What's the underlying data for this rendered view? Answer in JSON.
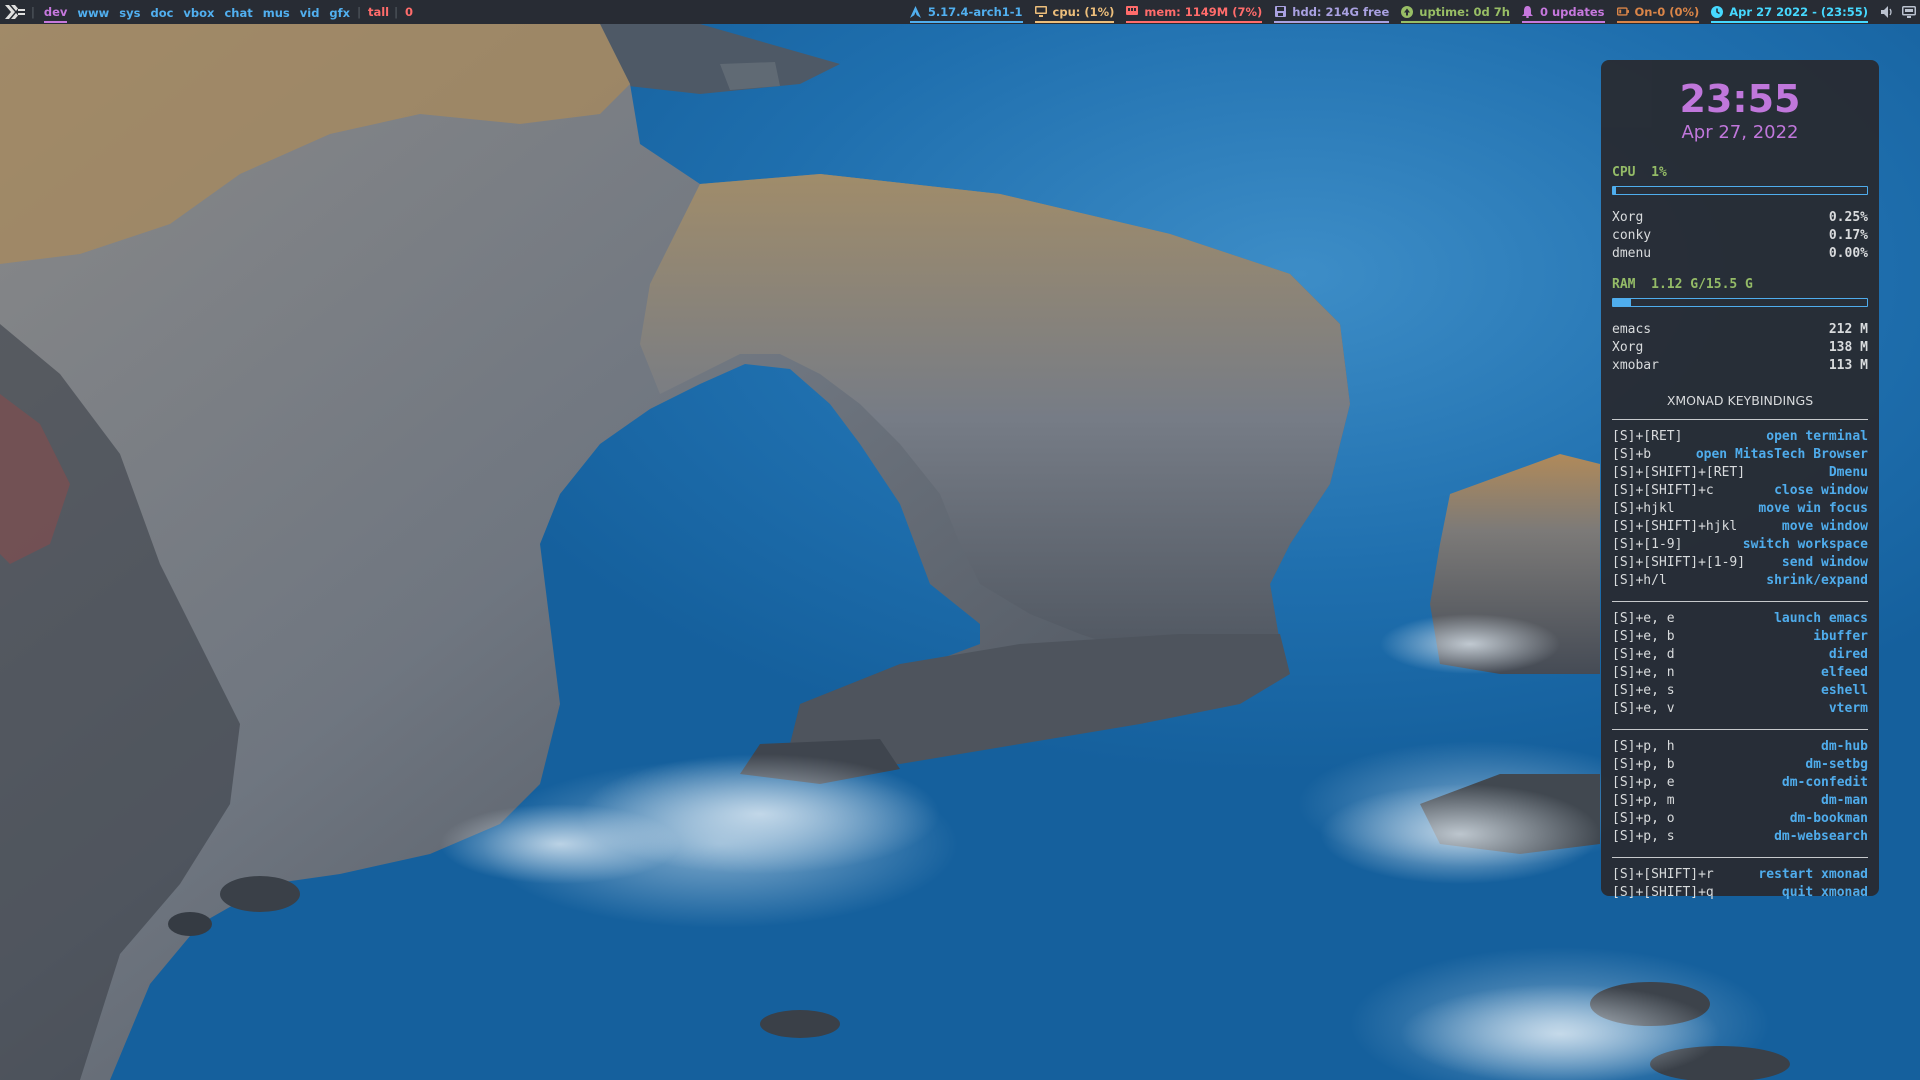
{
  "colors": {
    "bar_bg": "#282c34",
    "workspace": "#51afef",
    "workspace_active": "#c678dd",
    "layout": "#ff6c6b",
    "kernel": "#51afef",
    "cpu": "#ecbe7b",
    "mem": "#ff6c6b",
    "hdd": "#a9a1e1",
    "uptime": "#98be65",
    "updates": "#c678dd",
    "battery": "#da8548",
    "date": "#46d9ff",
    "conky_bg": "#282c34",
    "conky_accent": "#c678dd",
    "conky_green": "#98be65",
    "conky_blue": "#51afef"
  },
  "topbar": {
    "logo_icon": "xmonad-logo-icon",
    "workspaces": [
      "dev",
      "www",
      "sys",
      "doc",
      "vbox",
      "chat",
      "mus",
      "vid",
      "gfx"
    ],
    "active_workspace_index": 0,
    "layout": "tall",
    "window_count": "0",
    "modules": {
      "kernel": {
        "icon": "arch-linux-icon",
        "text": "5.17.4-arch1-1"
      },
      "cpu": {
        "icon": "monitor-icon",
        "text": "cpu: (1%)"
      },
      "mem": {
        "icon": "memory-icon",
        "text": "mem: 1149M (7%)"
      },
      "hdd": {
        "icon": "disk-icon",
        "text": "hdd: 214G free"
      },
      "uptime": {
        "icon": "uptime-icon",
        "text": "uptime: 0d 7h"
      },
      "updates": {
        "icon": "bell-icon",
        "text": "0 updates"
      },
      "battery": {
        "icon": "battery-icon",
        "text": "On-0 (0%)"
      },
      "date": {
        "icon": "clock-icon",
        "text": "Apr 27 2022 - (23:55)"
      }
    },
    "tray": [
      "volume-icon",
      "display-icon"
    ]
  },
  "conky": {
    "time": "23:55",
    "date": "Apr 27, 2022",
    "cpu": {
      "title": "CPU  1%",
      "usage_percent": 1,
      "processes": [
        {
          "name": "Xorg",
          "value": "0.25%"
        },
        {
          "name": "conky",
          "value": "0.17%"
        },
        {
          "name": "dmenu",
          "value": "0.00%"
        }
      ]
    },
    "ram": {
      "title": "RAM  1.12 G/15.5 G",
      "usage_percent": 7,
      "processes": [
        {
          "name": "emacs",
          "value": "212 M"
        },
        {
          "name": "Xorg",
          "value": "138 M"
        },
        {
          "name": "xmobar",
          "value": "113 M"
        }
      ]
    },
    "keybindings_title": "XMONAD KEYBINDINGS",
    "keybinding_groups": [
      [
        {
          "key": "[S]+[RET]",
          "action": "open terminal"
        },
        {
          "key": "[S]+b",
          "action": "open MitasTech Browser"
        },
        {
          "key": "[S]+[SHIFT]+[RET]",
          "action": "Dmenu"
        },
        {
          "key": "[S]+[SHIFT]+c",
          "action": "close window"
        },
        {
          "key": "[S]+hjkl",
          "action": "move win focus"
        },
        {
          "key": "[S]+[SHIFT]+hjkl",
          "action": "move window"
        },
        {
          "key": "[S]+[1-9]",
          "action": "switch workspace"
        },
        {
          "key": "[S]+[SHIFT]+[1-9]",
          "action": "send window"
        },
        {
          "key": "[S]+h/l",
          "action": "shrink/expand"
        }
      ],
      [
        {
          "key": "[S]+e, e",
          "action": "launch emacs"
        },
        {
          "key": "[S]+e, b",
          "action": "ibuffer"
        },
        {
          "key": "[S]+e, d",
          "action": "dired"
        },
        {
          "key": "[S]+e, n",
          "action": "elfeed"
        },
        {
          "key": "[S]+e, s",
          "action": "eshell"
        },
        {
          "key": "[S]+e, v",
          "action": "vterm"
        }
      ],
      [
        {
          "key": "[S]+p, h",
          "action": "dm-hub"
        },
        {
          "key": "[S]+p, b",
          "action": "dm-setbg"
        },
        {
          "key": "[S]+p, e",
          "action": "dm-confedit"
        },
        {
          "key": "[S]+p, m",
          "action": "dm-man"
        },
        {
          "key": "[S]+p, o",
          "action": "dm-bookman"
        },
        {
          "key": "[S]+p, s",
          "action": "dm-websearch"
        }
      ],
      [
        {
          "key": "[S]+[SHIFT]+r",
          "action": "restart xmonad"
        },
        {
          "key": "[S]+[SHIFT]+q",
          "action": "quit xmonad"
        }
      ]
    ]
  }
}
